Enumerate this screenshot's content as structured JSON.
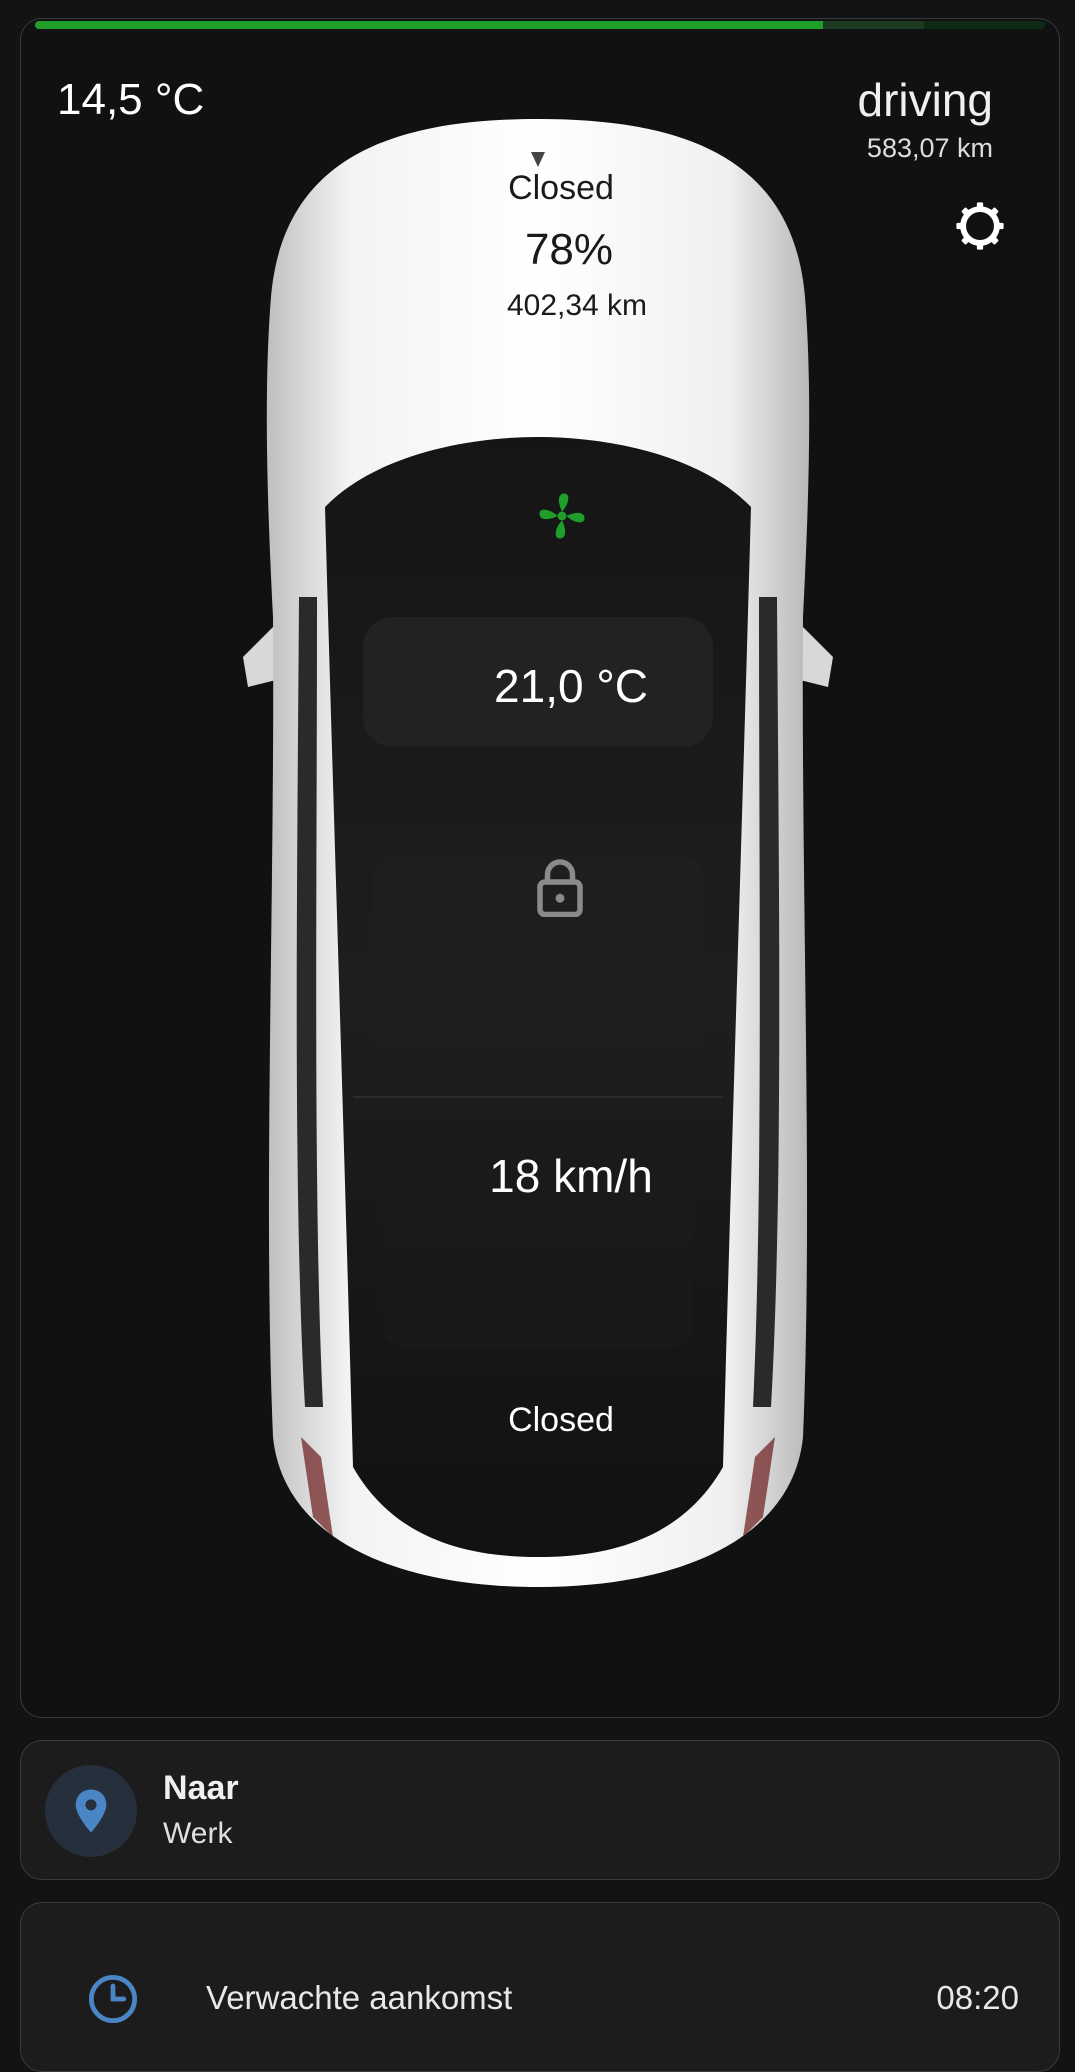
{
  "car_card": {
    "progress_percent": 78,
    "outside_temp": "14,5 °C",
    "state": "driving",
    "odometer": "583,07 km",
    "settings_icon": "gear-icon",
    "frunk_status": "Closed",
    "battery_level": "78%",
    "range": "402,34 km",
    "climate_icon": "fan-icon",
    "climate_color": "#1f9e2a",
    "inside_temp": "21,0 °C",
    "lock_icon": "lock-icon",
    "speed": "18 km/h",
    "trunk_status": "Closed"
  },
  "navigation": {
    "icon": "map-pin-icon",
    "title": "Naar",
    "destination": "Werk"
  },
  "eta": {
    "icon": "clock-icon",
    "label": "Verwachte aankomst",
    "value": "08:20"
  }
}
